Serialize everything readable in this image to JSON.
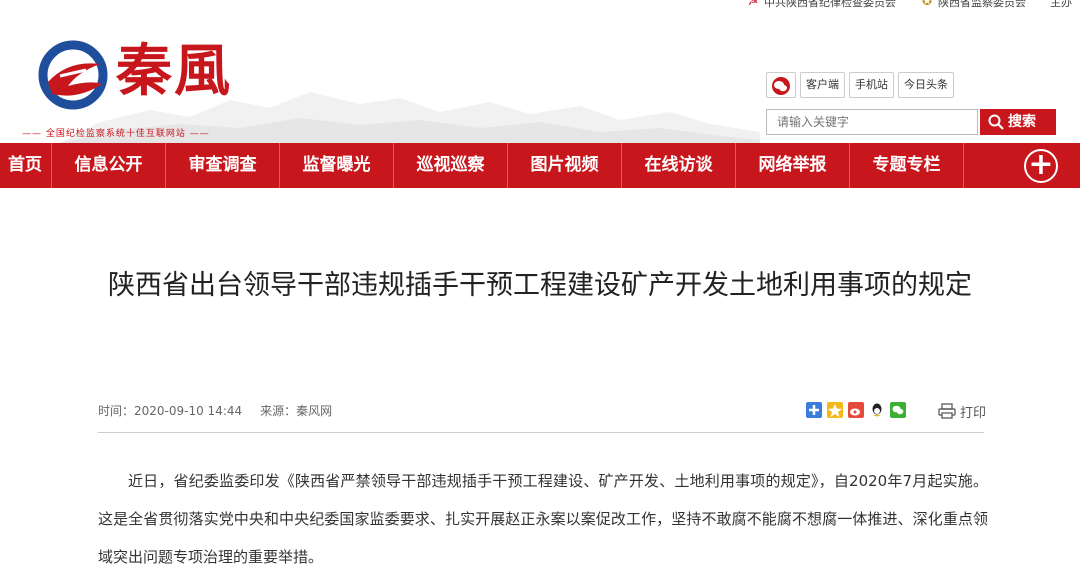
{
  "top_links": [
    "中共陕西省纪律检查委员会",
    "陕西省监察委员会",
    "主办"
  ],
  "logo": {
    "name": "秦風",
    "tagline": "—— 全国纪检监察系统十佳互联网站 ——"
  },
  "header_buttons": [
    "客户端",
    "手机站",
    "今日头条"
  ],
  "search": {
    "placeholder": "请输入关键字",
    "button": "搜索"
  },
  "nav": [
    "首页",
    "信息公开",
    "审查调查",
    "监督曝光",
    "巡视巡察",
    "图片视频",
    "在线访谈",
    "网络举报",
    "专题专栏"
  ],
  "article": {
    "title": "陕西省出台领导干部违规插手干预工程建设矿产开发土地利用事项的规定",
    "time": "时间：2020-09-10 14:44",
    "source": "来源：秦风网",
    "print": "打印",
    "paragraph": "近日，省纪委监委印发《陕西省严禁领导干部违规插手干预工程建设、矿产开发、土地利用事项的规定》，自2020年7月起实施。这是全省贯彻落实党中央和中央纪委国家监委要求、扎实开展赵正永案以案促改工作，坚持不敢腐不能腐不想腐一体推进、深化重点领域突出问题专项治理的重要举措。"
  },
  "colors": {
    "brand_red": "#c8161d",
    "nav_divider": "#e05a5f"
  }
}
